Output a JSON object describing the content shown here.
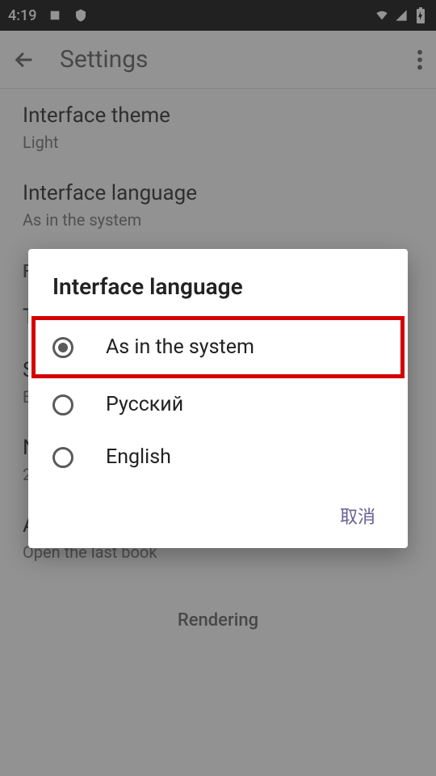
{
  "status_bar": {
    "time": "4:19",
    "icons_left": [
      "notification",
      "shield"
    ],
    "icons_right": [
      "wifi",
      "cell",
      "battery"
    ]
  },
  "app_bar": {
    "title": "Settings"
  },
  "settings": [
    {
      "label": "Interface theme",
      "value": "Light"
    },
    {
      "label": "Interface language",
      "value": "As in the system"
    }
  ],
  "partial_rows": {
    "section_f": "F",
    "row_t": "T",
    "row_s_label": "S",
    "row_s_value": "B",
    "row_n_label": "N",
    "row_n_value": "2",
    "action_label": "Action on startup",
    "action_value": "Open the last book",
    "rendering_header": "Rendering"
  },
  "dialog": {
    "title": "Interface language",
    "options": [
      {
        "label": "As in the system",
        "selected": true
      },
      {
        "label": "Русский",
        "selected": false
      },
      {
        "label": "English",
        "selected": false
      }
    ],
    "cancel": "取消"
  }
}
